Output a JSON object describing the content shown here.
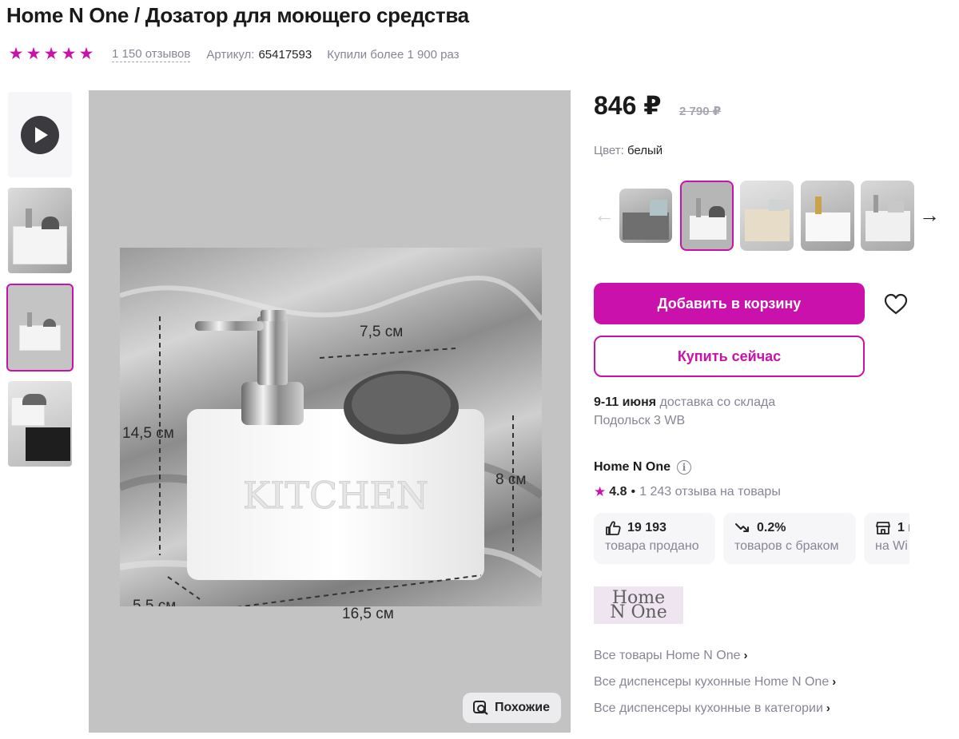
{
  "product": {
    "title": "Home N One / Дозатор для моющего средства",
    "rating_stars": 5,
    "reviews": "1 150 отзывов",
    "article_label": "Артикул:",
    "article_value": "65417593",
    "purchases": "Купили более 1 900 раз"
  },
  "gallery": {
    "similar_label": "Похожие",
    "photo_dimension_labels": {
      "height": "14,5 см",
      "compartment_width": "7,5 см",
      "compartment_height": "8 см",
      "depth": "5,5 см",
      "width": "16,5 см",
      "embossed_text": "KITCHEN"
    }
  },
  "price": {
    "current": "846 ₽",
    "old": "2 790 ₽"
  },
  "color": {
    "label": "Цвет:",
    "value": "белый"
  },
  "actions": {
    "add_to_cart": "Добавить в корзину",
    "buy_now": "Купить сейчас"
  },
  "delivery": {
    "date": "9-11 июня",
    "text": "доставка со склада",
    "warehouse": "Подольск 3 WB"
  },
  "seller": {
    "name": "Home N One",
    "rating": "4.8",
    "reviews": "1 243 отзыва на товары",
    "stats": [
      {
        "value": "19 193",
        "label": "товара продано",
        "icon": "thumbs-up-icon"
      },
      {
        "value": "0.2%",
        "label": "товаров с браком",
        "icon": "trend-down-icon"
      },
      {
        "value": "1 г",
        "label": "на Wi",
        "icon": "shop-icon"
      }
    ],
    "logo_line1": "Home",
    "logo_line2": "N One"
  },
  "links": [
    "Все товары Home N One",
    "Все диспенсеры кухонные Home N One",
    "Все диспенсеры кухонные в категории"
  ],
  "colors": {
    "accent": "#cb11ab",
    "muted_text": "#868695",
    "text": "#242424"
  }
}
